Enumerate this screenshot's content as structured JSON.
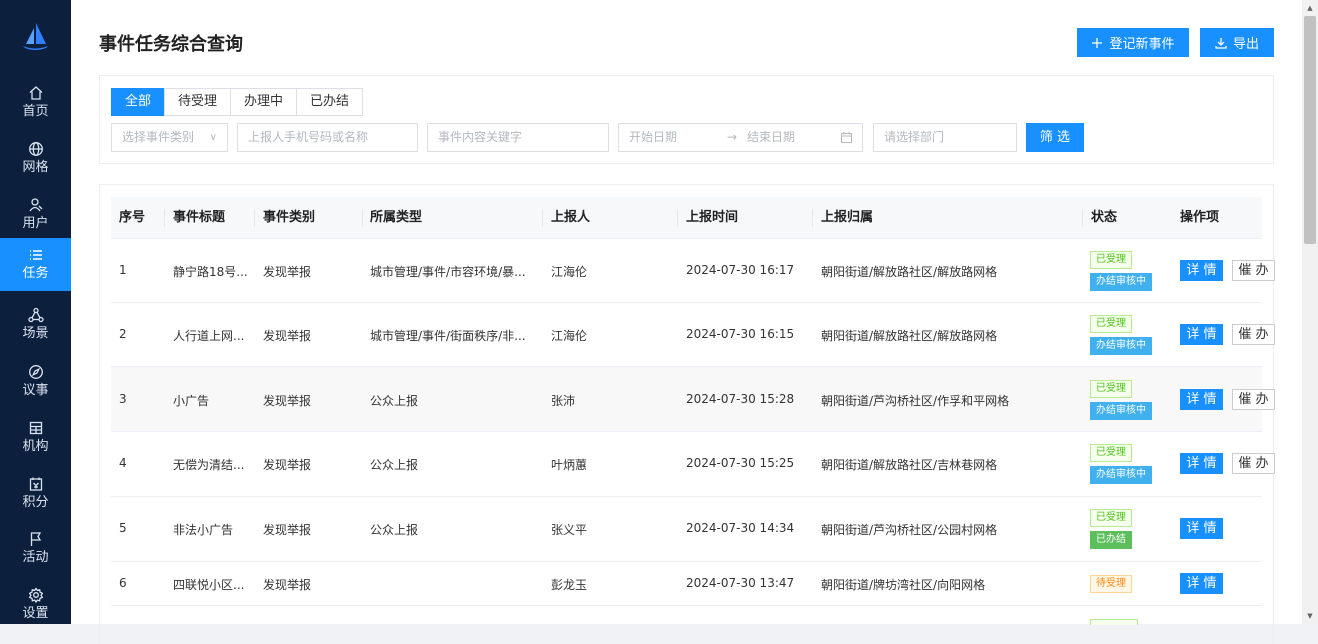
{
  "sidebar": {
    "items": [
      {
        "label": "首页",
        "icon": "home-icon"
      },
      {
        "label": "网格",
        "icon": "globe-icon"
      },
      {
        "label": "用户",
        "icon": "user-icon"
      },
      {
        "label": "任务",
        "icon": "list-icon"
      },
      {
        "label": "场景",
        "icon": "nodes-icon"
      },
      {
        "label": "议事",
        "icon": "compass-icon"
      },
      {
        "label": "机构",
        "icon": "building-icon"
      },
      {
        "label": "积分",
        "icon": "points-icon"
      },
      {
        "label": "活动",
        "icon": "flag-icon"
      },
      {
        "label": "设置",
        "icon": "gear-icon"
      }
    ],
    "active_index": 3,
    "accent": "#1890ff",
    "background": "#0c1f3d"
  },
  "header": {
    "title": "事件任务综合查询",
    "register_label": "登记新事件",
    "export_label": "导出"
  },
  "filters": {
    "tabs": [
      "全部",
      "待受理",
      "办理中",
      "已办结"
    ],
    "active_tab": 0,
    "category_placeholder": "选择事件类别",
    "reporter_placeholder": "上报人手机号码或名称",
    "keyword_placeholder": "事件内容关键字",
    "start_date_placeholder": "开始日期",
    "date_separator": "→",
    "end_date_placeholder": "结束日期",
    "department_placeholder": "请选择部门",
    "filter_label": "筛 选"
  },
  "table": {
    "columns": [
      "序号",
      "事件标题",
      "事件类别",
      "所属类型",
      "上报人",
      "上报时间",
      "上报归属",
      "状态",
      "操作项"
    ],
    "detail_label": "详 情",
    "urge_label": "催 办",
    "rows": [
      {
        "no": "1",
        "title": "静宁路18号...",
        "category": "发现举报",
        "type": "城市管理/事件/市容环境/暴...",
        "reporter": "江海伦",
        "time": "2024-07-30 16:17",
        "belong": "朝阳街道/解放路社区/解放路网格",
        "status1": "已受理",
        "status2": "办结审核中",
        "urge": true
      },
      {
        "no": "2",
        "title": "人行道上网...",
        "category": "发现举报",
        "type": "城市管理/事件/街面秩序/非...",
        "reporter": "江海伦",
        "time": "2024-07-30 16:15",
        "belong": "朝阳街道/解放路社区/解放路网格",
        "status1": "已受理",
        "status2": "办结审核中",
        "urge": true
      },
      {
        "no": "3",
        "title": "小广告",
        "category": "发现举报",
        "type": "公众上报",
        "reporter": "张沛",
        "time": "2024-07-30 15:28",
        "belong": "朝阳街道/芦沟桥社区/作孚和平网格",
        "status1": "已受理",
        "status2": "办结审核中",
        "urge": true
      },
      {
        "no": "4",
        "title": "无偿为清结...",
        "category": "发现举报",
        "type": "公众上报",
        "reporter": "叶炳蕙",
        "time": "2024-07-30 15:25",
        "belong": "朝阳街道/解放路社区/吉林巷网格",
        "status1": "已受理",
        "status2": "办结审核中",
        "urge": true
      },
      {
        "no": "5",
        "title": "非法小广告",
        "category": "发现举报",
        "type": "公众上报",
        "reporter": "张义平",
        "time": "2024-07-30 14:34",
        "belong": "朝阳街道/芦沟桥社区/公园村网格",
        "status1": "已受理",
        "status2": "已办结",
        "urge": false
      },
      {
        "no": "6",
        "title": "四联悦小区...",
        "category": "发现举报",
        "type": "",
        "reporter": "彭龙玉",
        "time": "2024-07-30 13:47",
        "belong": "朝阳街道/牌坊湾社区/向阳网格",
        "status1": "待受理",
        "status2": "",
        "urge": false
      }
    ]
  }
}
